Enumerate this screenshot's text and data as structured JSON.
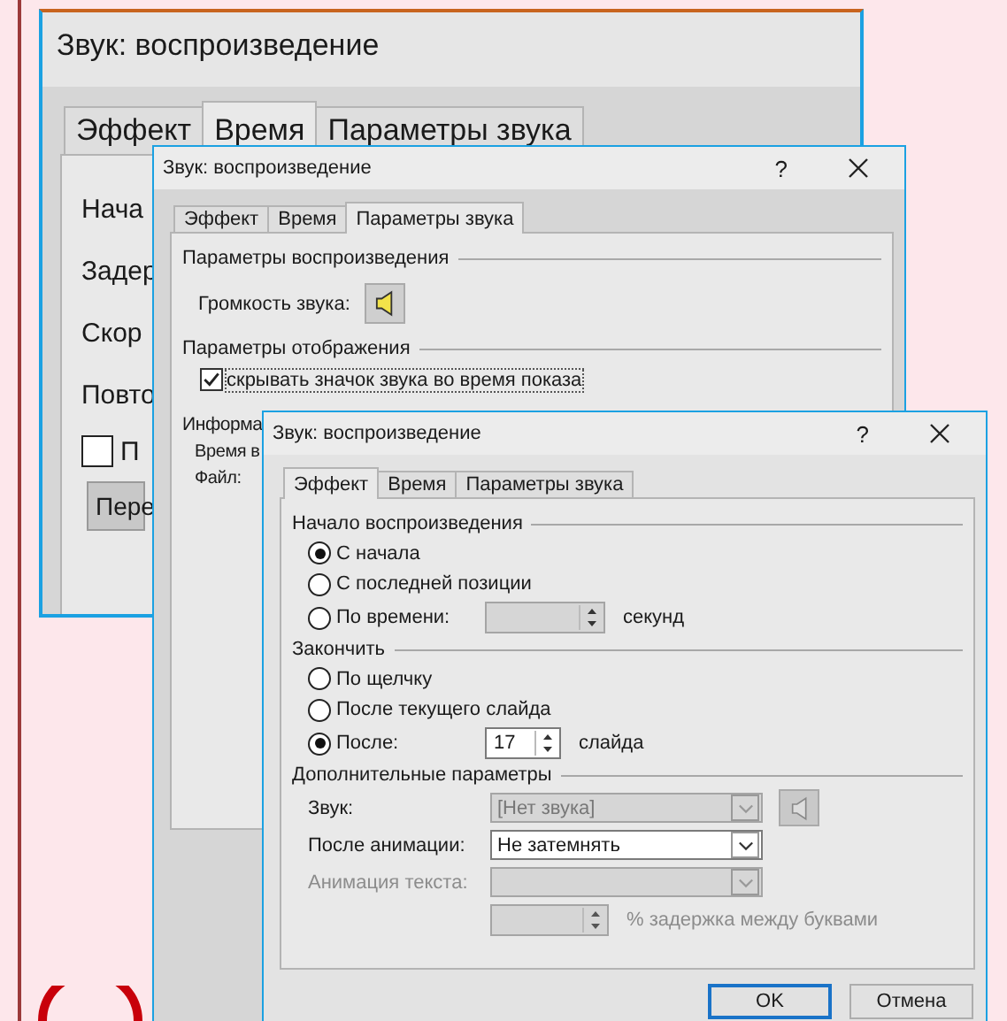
{
  "back_dialog": {
    "title": "Звук: воспроизведение",
    "tabs": [
      {
        "label": "Эффект",
        "selected": false
      },
      {
        "label": "Время",
        "selected": true
      },
      {
        "label": "Параметры звука",
        "selected": false
      }
    ],
    "labels": [
      "Нача",
      "Задер",
      "Скор",
      "Повто"
    ],
    "checkbox": {
      "label": "П",
      "checked": false
    },
    "button": "Пере"
  },
  "middle_dialog": {
    "title": "Звук: воспроизведение",
    "help": "?",
    "tabs": [
      {
        "label": "Эффект",
        "selected": false
      },
      {
        "label": "Время",
        "selected": false
      },
      {
        "label": "Параметры звука",
        "selected": true
      }
    ],
    "playback_heading": "Параметры воспроизведения",
    "volume_label": "Громкость звука:",
    "display_heading": "Параметры отображения",
    "hide_icon": {
      "label": "скрывать значок звука во время показа",
      "checked": true
    },
    "info_heading": "Информа",
    "info_lines": [
      "Время в",
      "Файл:"
    ]
  },
  "front_dialog": {
    "title": "Звук: воспроизведение",
    "help": "?",
    "tabs": [
      {
        "label": "Эффект",
        "selected": true
      },
      {
        "label": "Время",
        "selected": false
      },
      {
        "label": "Параметры звука",
        "selected": false
      }
    ],
    "start_heading": "Начало воспроизведения",
    "start_options": [
      {
        "kind": "plain",
        "label": "С начала",
        "selected": true
      },
      {
        "kind": "plain",
        "label": "С последней позиции",
        "selected": false
      },
      {
        "kind": "spin",
        "label": "По времени:",
        "selected": false,
        "disabled": true,
        "unit": "секунд"
      }
    ],
    "end_heading": "Закончить",
    "end_options": [
      {
        "kind": "plain",
        "label": "По щелчку",
        "selected": false
      },
      {
        "kind": "plain",
        "label": "После текущего слайда",
        "selected": false
      },
      {
        "kind": "spin",
        "label": "После:",
        "selected": true,
        "disabled": false,
        "value": "17",
        "unit": "слайда"
      }
    ],
    "extra_heading": "Дополнительные параметры",
    "fields": [
      {
        "kind": "sound",
        "label": "Звук:",
        "value": "[Нет звука]",
        "disabled": true
      },
      {
        "kind": "dropdown",
        "label": "После анимации:",
        "value": "Не затемнять",
        "disabled": false
      },
      {
        "kind": "dropdown",
        "label": "Анимация текста:",
        "disabled": true
      },
      {
        "kind": "spin",
        "disabled": true,
        "unit": "% задержка между буквами"
      }
    ],
    "buttons": [
      {
        "label": "OK",
        "default": true
      },
      {
        "label": "Отмена",
        "default": false
      }
    ]
  }
}
